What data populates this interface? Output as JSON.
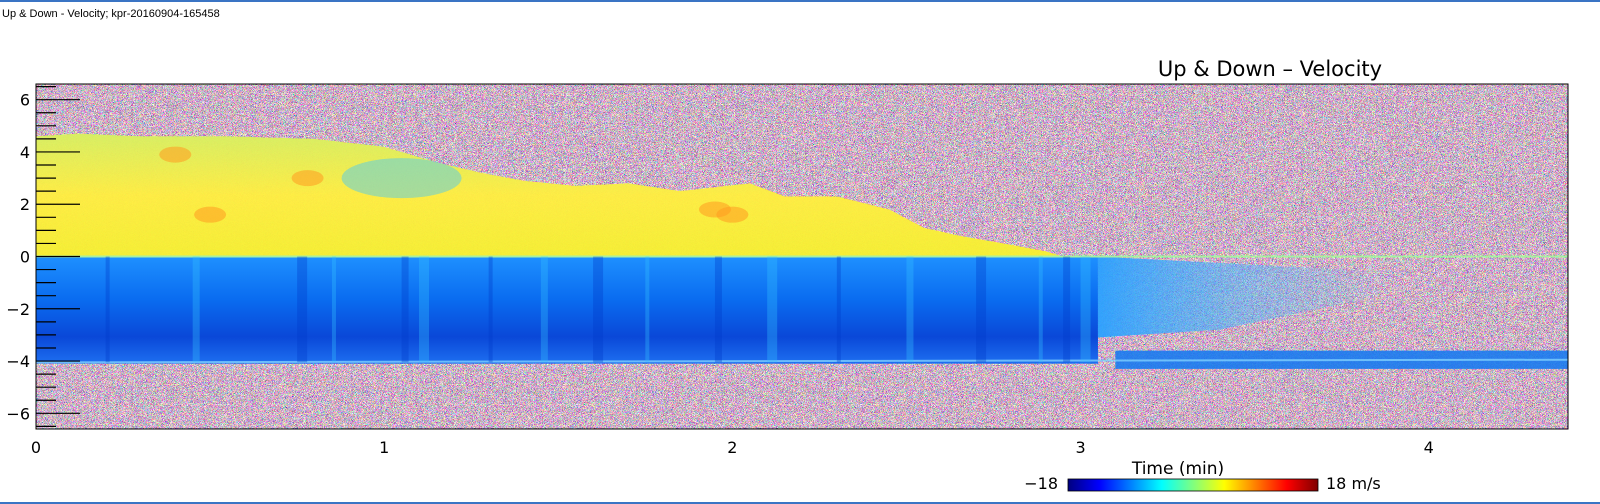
{
  "window": {
    "title": "Up & Down - Velocity; kpr-20160904-165458"
  },
  "chart_data": {
    "type": "heatmap",
    "title": "Up & Down – Velocity",
    "xlabel": "Time (min)",
    "ylabel": "",
    "xlim": [
      0,
      4.4
    ],
    "ylim": [
      -6.6,
      6.6
    ],
    "x_ticks": [
      0,
      1,
      2,
      3,
      4
    ],
    "y_ticks": [
      6,
      4,
      2,
      0,
      -2,
      -4,
      -6
    ],
    "y_tick_labels": [
      "6",
      "4",
      "2",
      "0",
      "−2",
      "−4",
      "−6"
    ],
    "colorbar": {
      "min_label": "−18",
      "max_label": "18 m/s",
      "min": -18,
      "max": 18,
      "colors": [
        "#00007f",
        "#0000ff",
        "#007fff",
        "#00ffff",
        "#7fff7f",
        "#ffff00",
        "#ff7f00",
        "#ff0000",
        "#7f0000"
      ]
    },
    "regions": {
      "upper_band": {
        "y_range": [
          0,
          4.6
        ],
        "velocity_m_s": 3,
        "extent_min": [
          0,
          2.9
        ]
      },
      "lower_band": {
        "y_range": [
          -4.1,
          0
        ],
        "velocity_m_s": -11,
        "extent_min": [
          0,
          3.05
        ]
      },
      "fading_tail": {
        "y_range": [
          -3.1,
          0
        ],
        "velocity_m_s": -6,
        "extent_min": [
          3.05,
          3.9
        ]
      },
      "lower_streak": {
        "y_range": [
          -4.3,
          -3.6
        ],
        "velocity_m_s": -12,
        "extent_min": [
          3.1,
          4.4
        ]
      }
    },
    "grid": false
  }
}
